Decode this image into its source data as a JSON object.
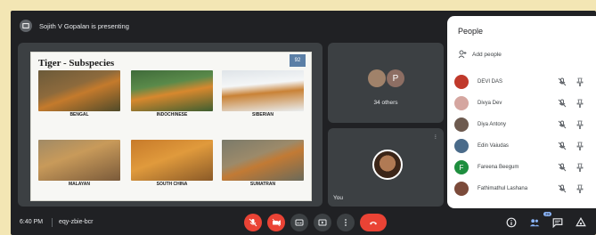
{
  "topbar": {
    "presenting": "Sojith V Gopalan is presenting"
  },
  "slide": {
    "title": "Tiger - Subspecies",
    "number": "92",
    "tigers": [
      {
        "label": "BENGAL"
      },
      {
        "label": "INDOCHINESE"
      },
      {
        "label": "SIBERIAN"
      },
      {
        "label": "MALAYAN"
      },
      {
        "label": "SOUTH CHINA"
      },
      {
        "label": "SUMATRAN"
      }
    ]
  },
  "others": {
    "label": "34 others",
    "avatar_letter": "P"
  },
  "you": {
    "label": "You",
    "more": "⁝"
  },
  "people": {
    "title": "People",
    "add_label": "Add people",
    "participants": [
      {
        "name": "DEVI DAS",
        "avatar_color": "#c0392b",
        "initial": ""
      },
      {
        "name": "Divya Dev",
        "avatar_color": "#d5a6a0",
        "initial": ""
      },
      {
        "name": "Diya Antony",
        "avatar_color": "#6d5a4f",
        "initial": ""
      },
      {
        "name": "Edin Vaiudas",
        "avatar_color": "#4a6b8a",
        "initial": ""
      },
      {
        "name": "Fareena Beegum",
        "avatar_color": "#1e8e3e",
        "initial": "F"
      },
      {
        "name": "Fathimathul Lashana",
        "avatar_color": "#7b4a3a",
        "initial": ""
      }
    ]
  },
  "bottombar": {
    "time": "6:40 PM",
    "meeting_code": "eqy-zbie-bcr",
    "participant_count": "39"
  },
  "colors": {
    "bg": "#202124",
    "tile": "#3c4043",
    "red": "#ea4335",
    "accent": "#8ab4f8"
  }
}
